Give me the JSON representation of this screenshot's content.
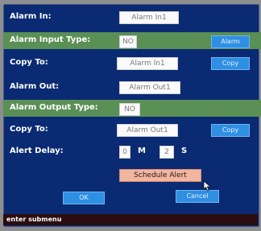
{
  "form": {
    "alarm_in": {
      "label": "Alarm In:",
      "value": "Alarm In1"
    },
    "alarm_input_type": {
      "label": "Alarm Input Type:",
      "value": "NO",
      "button": "Alarm"
    },
    "copy_to_in": {
      "label": "Copy To:",
      "value": "Alarm In1",
      "button": "Copy"
    },
    "alarm_out": {
      "label": "Alarm Out:",
      "value": "Alarm Out1"
    },
    "alarm_output_type": {
      "label": "Alarm Output Type:",
      "value": "NO"
    },
    "copy_to_out": {
      "label": "Copy To:",
      "value": "Alarm Out1",
      "button": "Copy"
    },
    "alert_delay": {
      "label": "Alert Delay:",
      "minutes": "0",
      "minutes_unit": "M",
      "seconds": "2",
      "seconds_unit": "S"
    }
  },
  "schedule_button": "Schedule Alert",
  "ok_button": "OK",
  "cancel_button": "Cancel",
  "status_bar": "enter submenu",
  "colors": {
    "panel": "#0a2a73",
    "band": "#5a8f55",
    "button": "#2f8fe2",
    "schedule": "#f2b59f",
    "status": "#2a0d10"
  },
  "cursor_icon": "mouse-pointer-icon"
}
